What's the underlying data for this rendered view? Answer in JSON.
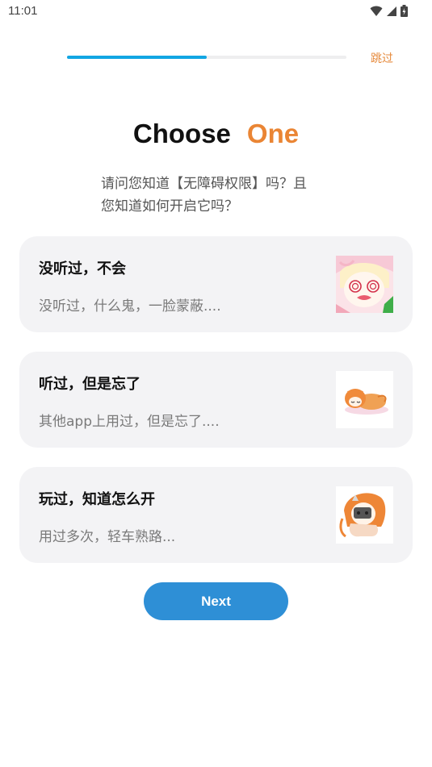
{
  "status_bar": {
    "time": "11:01",
    "icons": [
      "wifi-icon",
      "signal-icon",
      "battery-icon"
    ]
  },
  "progress": {
    "fraction": 0.5,
    "fill_color": "#12a6e3",
    "track_color": "#eeeeef"
  },
  "header": {
    "skip_label": "跳过",
    "title_word": "Choose",
    "title_accent": "One",
    "accent_color": "#ea8534"
  },
  "question": {
    "line1": "请问您知道【无障碍权限】吗？且",
    "line2": "您知道如何开启它吗？"
  },
  "options": [
    {
      "title": "没听过，不会",
      "description": "没听过，什么鬼，一脸蒙蔽....",
      "image": "confused-anime-girl-image"
    },
    {
      "title": "听过，但是忘了",
      "description": "其他app上用过，但是忘了....",
      "image": "sleeping-anime-girl-image"
    },
    {
      "title": "玩过，知道怎么开",
      "description": "用过多次，轻车熟路...",
      "image": "gaming-anime-girl-image"
    }
  ],
  "footer": {
    "next_label": "Next",
    "button_color": "#2e8fd6"
  }
}
